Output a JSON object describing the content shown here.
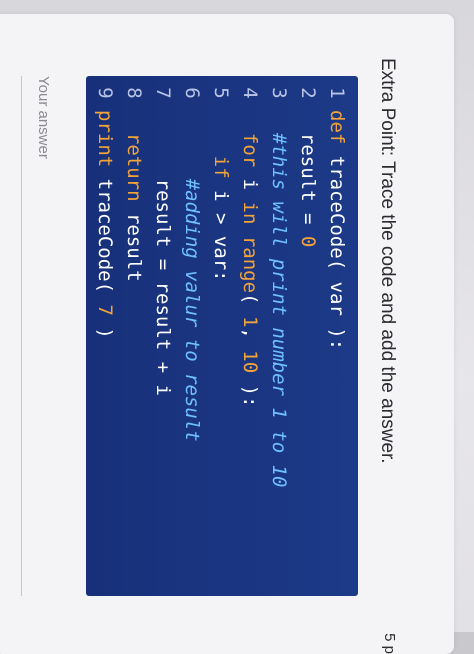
{
  "question": {
    "title": "Extra Point: Trace the code and add the answer.",
    "points_label": "5 p"
  },
  "code": {
    "lines": [
      {
        "num": "1",
        "indent": "",
        "parts": [
          {
            "t": "def",
            "c": "kw"
          },
          {
            "t": " traceCode( var ):",
            "c": ""
          }
        ]
      },
      {
        "num": "2",
        "indent": "  ",
        "parts": [
          {
            "t": "result = ",
            "c": ""
          },
          {
            "t": "0",
            "c": "num"
          }
        ]
      },
      {
        "num": "3",
        "indent": "  ",
        "parts": [
          {
            "t": "#this will print number 1 to 10",
            "c": "cm"
          }
        ]
      },
      {
        "num": "4",
        "indent": "  ",
        "parts": [
          {
            "t": "for",
            "c": "kw"
          },
          {
            "t": " i ",
            "c": ""
          },
          {
            "t": "in range",
            "c": "kw"
          },
          {
            "t": "( ",
            "c": ""
          },
          {
            "t": "1",
            "c": "num"
          },
          {
            "t": ", ",
            "c": ""
          },
          {
            "t": "10",
            "c": "num"
          },
          {
            "t": " ):",
            "c": ""
          }
        ]
      },
      {
        "num": "5",
        "indent": "    ",
        "parts": [
          {
            "t": "if",
            "c": "kw"
          },
          {
            "t": " i > var:",
            "c": ""
          }
        ]
      },
      {
        "num": "6",
        "indent": "      ",
        "parts": [
          {
            "t": "#adding valur to result",
            "c": "cm"
          }
        ]
      },
      {
        "num": "7",
        "indent": "      ",
        "parts": [
          {
            "t": "result = result + i",
            "c": ""
          }
        ]
      },
      {
        "num": "8",
        "indent": "  ",
        "parts": [
          {
            "t": "return",
            "c": "kw"
          },
          {
            "t": " result",
            "c": ""
          }
        ]
      },
      {
        "num": "9",
        "indent": "",
        "parts": [
          {
            "t": "print",
            "c": "kw"
          },
          {
            "t": " traceCode( ",
            "c": ""
          },
          {
            "t": "7",
            "c": "num"
          },
          {
            "t": " )",
            "c": ""
          }
        ]
      }
    ]
  },
  "answer": {
    "placeholder": "Your answer"
  }
}
